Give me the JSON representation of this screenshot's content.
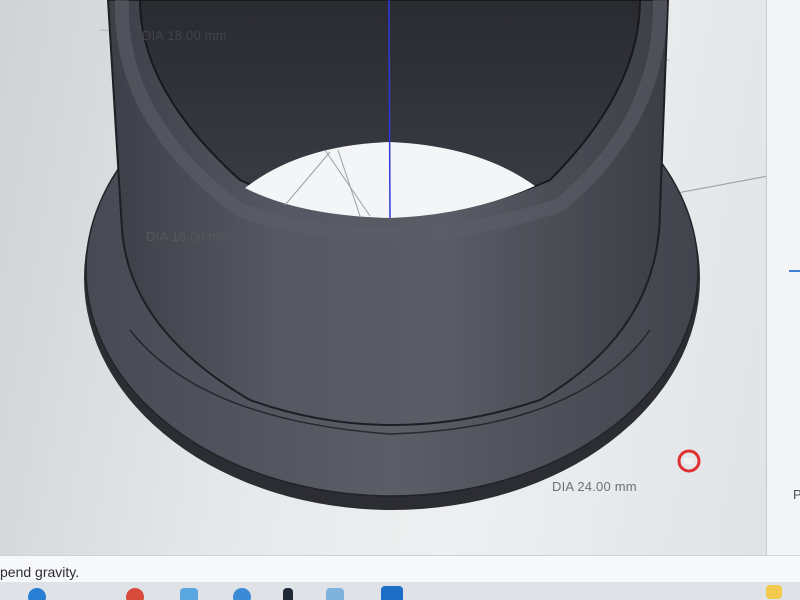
{
  "viewport": {
    "dimensions": {
      "top": "DIA 18.00 mm",
      "middle": "DIA 16.00 mm",
      "bottom": "DIA 24.00 mm"
    },
    "model": {
      "name": "flanged bushing",
      "body_color": "#4a4c55",
      "edge_color": "#1e1f24"
    },
    "axis_color": "#2d39d8"
  },
  "right_panel": {
    "partial_label": "P"
  },
  "status_bar": {
    "message": "pend gravity."
  },
  "taskbar": {
    "icons": [
      "browser-icon",
      "chrome-icon",
      "file-explorer-icon",
      "edge-icon",
      "notion-icon",
      "photos-icon",
      "ultimaker-cura-icon",
      "notification-icon"
    ]
  }
}
